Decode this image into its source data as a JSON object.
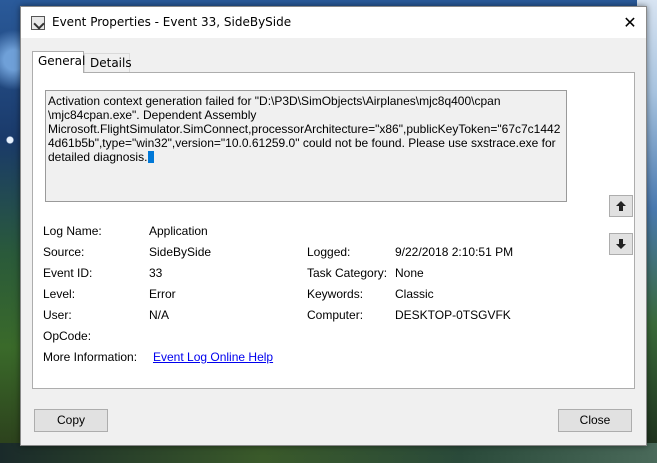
{
  "window": {
    "title": "Event Properties - Event 33, SideBySide",
    "close_glyph": "✕"
  },
  "tabs": [
    {
      "label": "General",
      "active": true
    },
    {
      "label": "Details",
      "active": false
    }
  ],
  "description": {
    "lines": [
      "Activation context generation failed for \"D:\\P3D\\SimObjects\\Airplanes\\mjc8q400\\cpan",
      "\\mjc84cpan.exe\". Dependent Assembly",
      "Microsoft.FlightSimulator.SimConnect,processorArchitecture=\"x86\",publicKeyToken=\"67c7c1442",
      "4d61b5b\",type=\"win32\",version=\"10.0.61259.0\" could not be found. Please use sxstrace.exe for",
      "detailed diagnosis."
    ]
  },
  "fields": {
    "log_name": {
      "label": "Log Name:",
      "value": "Application"
    },
    "source": {
      "label": "Source:",
      "value": "SideBySide"
    },
    "logged": {
      "label": "Logged:",
      "value": "9/22/2018 2:10:51 PM"
    },
    "event_id": {
      "label": "Event ID:",
      "value": "33"
    },
    "task_category": {
      "label": "Task Category:",
      "value": "None"
    },
    "level": {
      "label": "Level:",
      "value": "Error"
    },
    "keywords": {
      "label": "Keywords:",
      "value": "Classic"
    },
    "user": {
      "label": "User:",
      "value": "N/A"
    },
    "computer": {
      "label": "Computer:",
      "value": "DESKTOP-0TSGVFK"
    },
    "opcode": {
      "label": "OpCode:",
      "value": ""
    },
    "more_info": {
      "label": "More Information:",
      "link": "Event Log Online Help"
    }
  },
  "buttons": {
    "copy": "Copy",
    "close": "Close"
  },
  "icons": {
    "title": "event-viewer-icon",
    "up": "arrow-up-icon",
    "down": "arrow-down-icon"
  },
  "colors": {
    "link": "#0000ee",
    "caret": "#0078d7",
    "dialog_bg": "#f0f0f0"
  }
}
